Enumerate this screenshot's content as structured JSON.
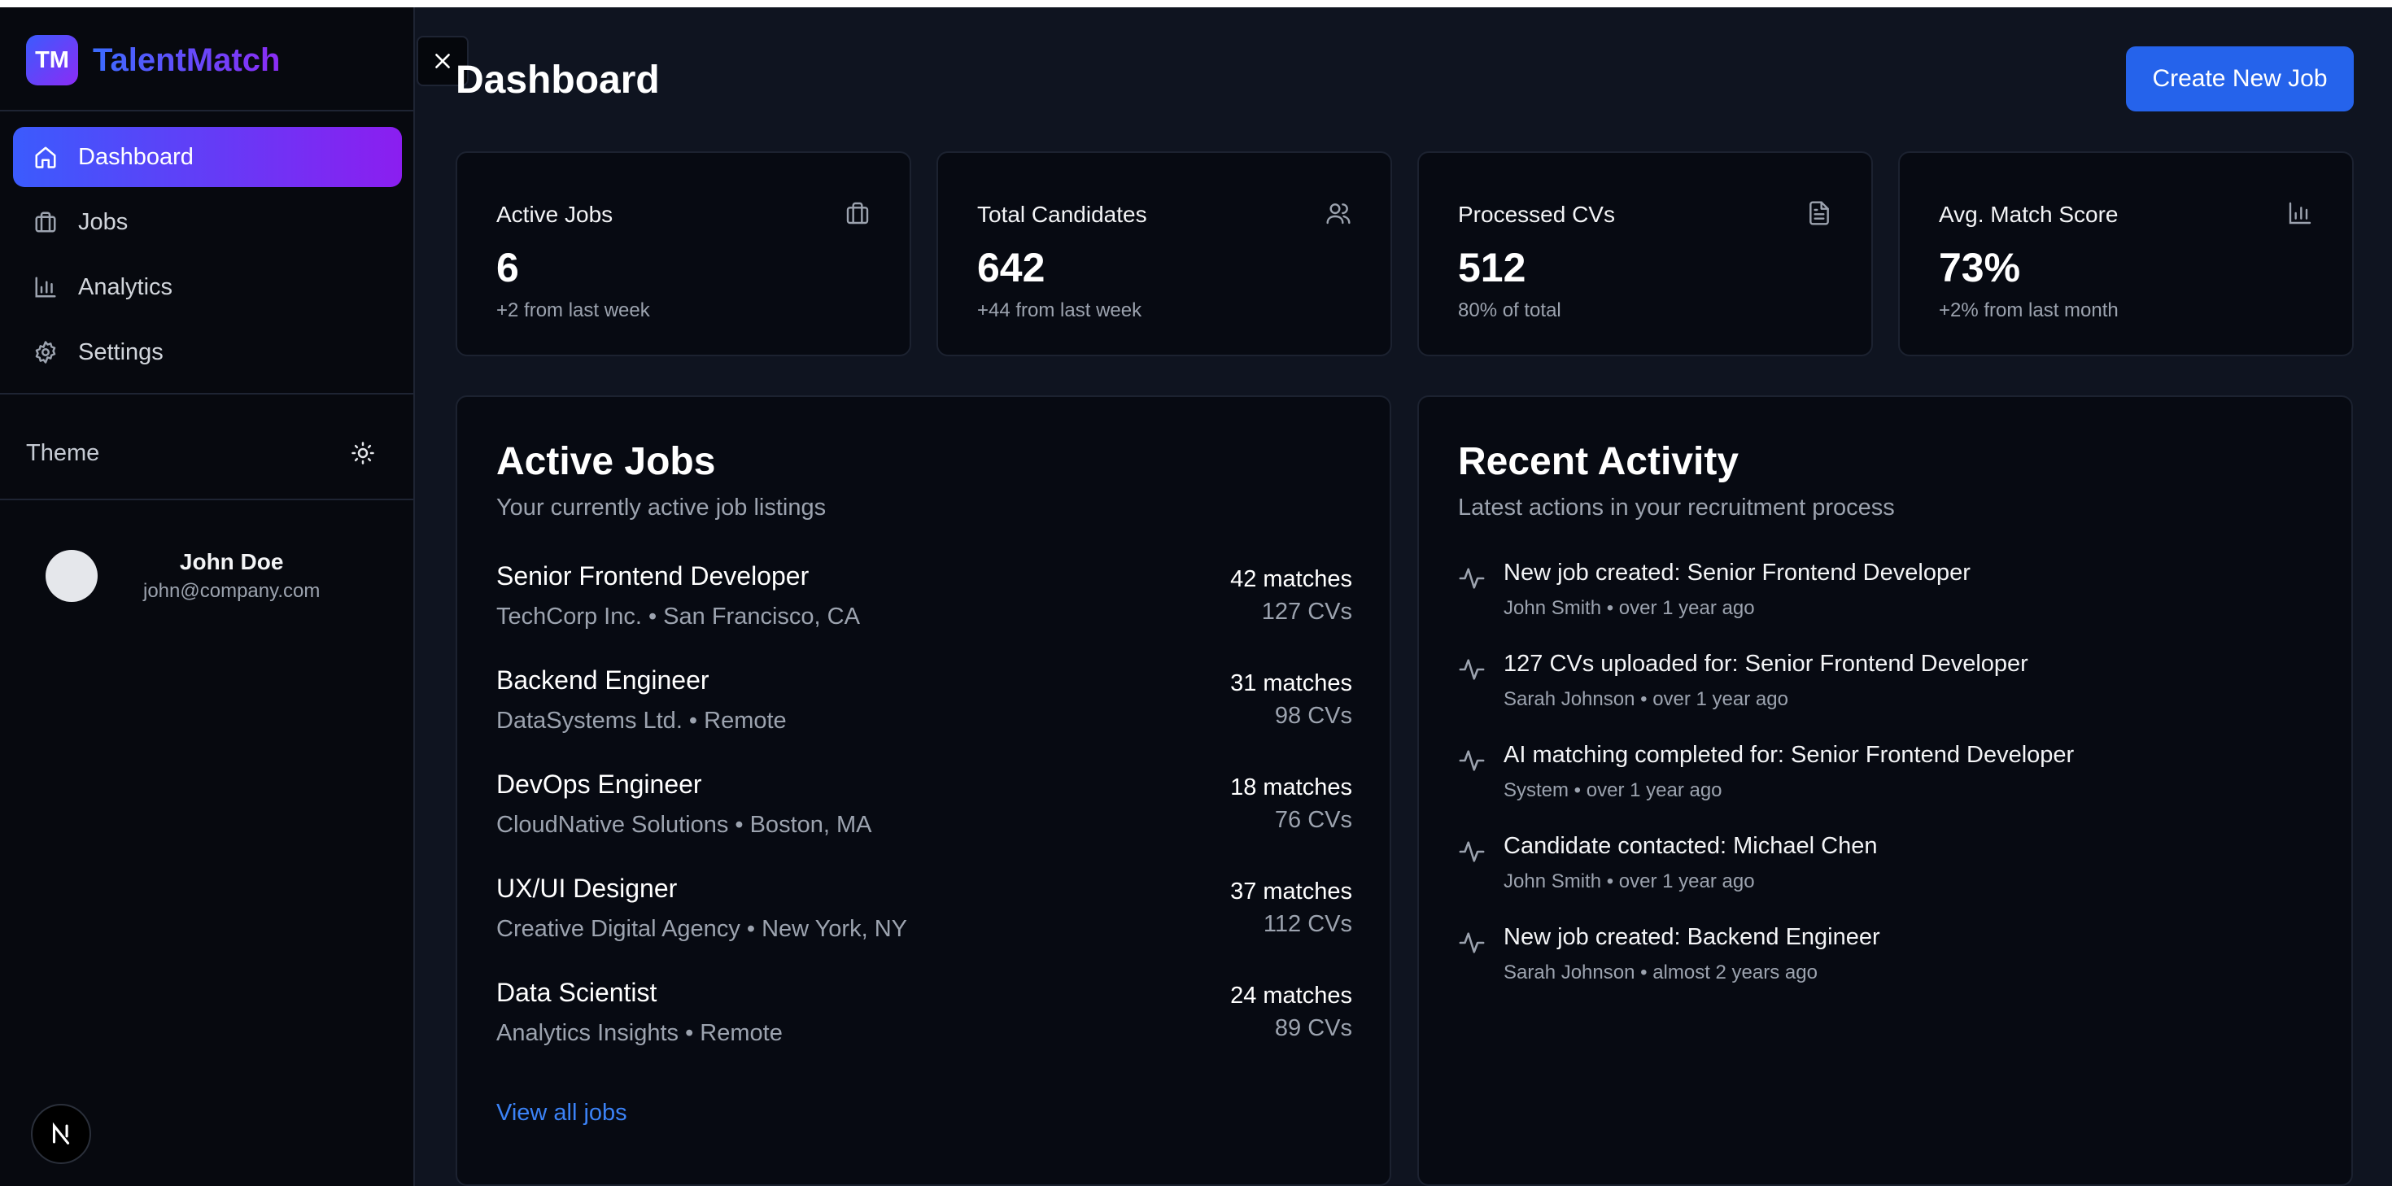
{
  "app": {
    "logo_text": "TM",
    "name": "TalentMatch"
  },
  "sidebar": {
    "items": [
      {
        "label": "Dashboard",
        "icon": "home-icon",
        "active": true
      },
      {
        "label": "Jobs",
        "icon": "briefcase-icon",
        "active": false
      },
      {
        "label": "Analytics",
        "icon": "bar-chart-icon",
        "active": false
      },
      {
        "label": "Settings",
        "icon": "gear-icon",
        "active": false
      }
    ],
    "theme_label": "Theme",
    "theme_icon": "sun-icon",
    "user": {
      "name": "John Doe",
      "email": "john@company.com"
    },
    "framework_badge": "N"
  },
  "header": {
    "title": "Dashboard",
    "create_button": "Create New Job"
  },
  "stats": [
    {
      "title": "Active Jobs",
      "value": "6",
      "sub": "+2 from last week",
      "icon": "briefcase-icon"
    },
    {
      "title": "Total Candidates",
      "value": "642",
      "sub": "+44 from last week",
      "icon": "users-icon"
    },
    {
      "title": "Processed CVs",
      "value": "512",
      "sub": "80% of total",
      "icon": "document-icon"
    },
    {
      "title": "Avg. Match Score",
      "value": "73%",
      "sub": "+2% from last month",
      "icon": "bar-chart-icon"
    }
  ],
  "active_jobs": {
    "title": "Active Jobs",
    "subtitle": "Your currently active job listings",
    "jobs": [
      {
        "title": "Senior Frontend Developer",
        "meta": "TechCorp Inc. • San Francisco, CA",
        "matches": "42 matches",
        "cvs": "127 CVs"
      },
      {
        "title": "Backend Engineer",
        "meta": "DataSystems Ltd. • Remote",
        "matches": "31 matches",
        "cvs": "98 CVs"
      },
      {
        "title": "DevOps Engineer",
        "meta": "CloudNative Solutions • Boston, MA",
        "matches": "18 matches",
        "cvs": "76 CVs"
      },
      {
        "title": "UX/UI Designer",
        "meta": "Creative Digital Agency • New York, NY",
        "matches": "37 matches",
        "cvs": "112 CVs"
      },
      {
        "title": "Data Scientist",
        "meta": "Analytics Insights • Remote",
        "matches": "24 matches",
        "cvs": "89 CVs"
      }
    ],
    "view_all": "View all jobs"
  },
  "recent_activity": {
    "title": "Recent Activity",
    "subtitle": "Latest actions in your recruitment process",
    "items": [
      {
        "title": "New job created: Senior Frontend Developer",
        "meta": "John Smith • over 1 year ago"
      },
      {
        "title": "127 CVs uploaded for: Senior Frontend Developer",
        "meta": "Sarah Johnson • over 1 year ago"
      },
      {
        "title": "AI matching completed for: Senior Frontend Developer",
        "meta": "System • over 1 year ago"
      },
      {
        "title": "Candidate contacted: Michael Chen",
        "meta": "John Smith • over 1 year ago"
      },
      {
        "title": "New job created: Backend Engineer",
        "meta": "Sarah Johnson • almost 2 years ago"
      }
    ]
  },
  "colors": {
    "accent": "#2563eb",
    "brand_gradient_start": "#3b5bfd",
    "brand_gradient_end": "#8b2cf5",
    "link": "#3b82f6"
  }
}
